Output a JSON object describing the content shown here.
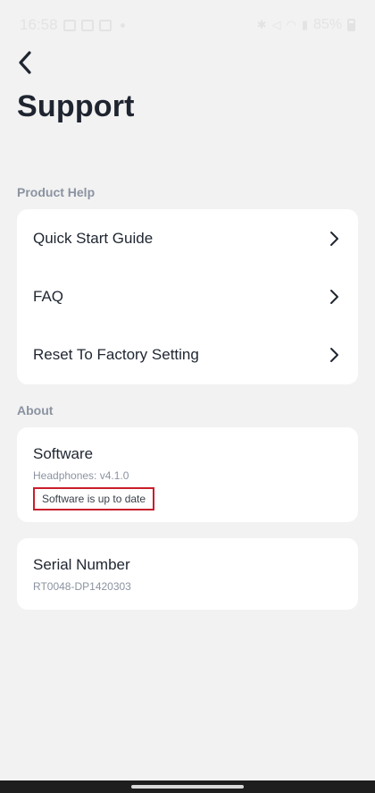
{
  "status_bar": {
    "time": "16:58",
    "battery": "85%"
  },
  "header": {
    "title": "Support"
  },
  "sections": {
    "product_help": {
      "label": "Product Help",
      "items": [
        {
          "label": "Quick Start Guide"
        },
        {
          "label": "FAQ"
        },
        {
          "label": "Reset To Factory Setting"
        }
      ]
    },
    "about": {
      "label": "About",
      "software": {
        "title": "Software",
        "version": "Headphones: v4.1.0",
        "status": "Software is up to date"
      },
      "serial": {
        "title": "Serial Number",
        "value": "RT0048-DP1420303"
      }
    }
  },
  "colors": {
    "background": "#f2f2f2",
    "card": "#ffffff",
    "text_primary": "#1f2530",
    "text_secondary": "#8b93a1",
    "highlight_border": "#c91f2b"
  },
  "icons": {
    "back": "chevron-left-icon",
    "row_chevron": "chevron-right-icon"
  }
}
